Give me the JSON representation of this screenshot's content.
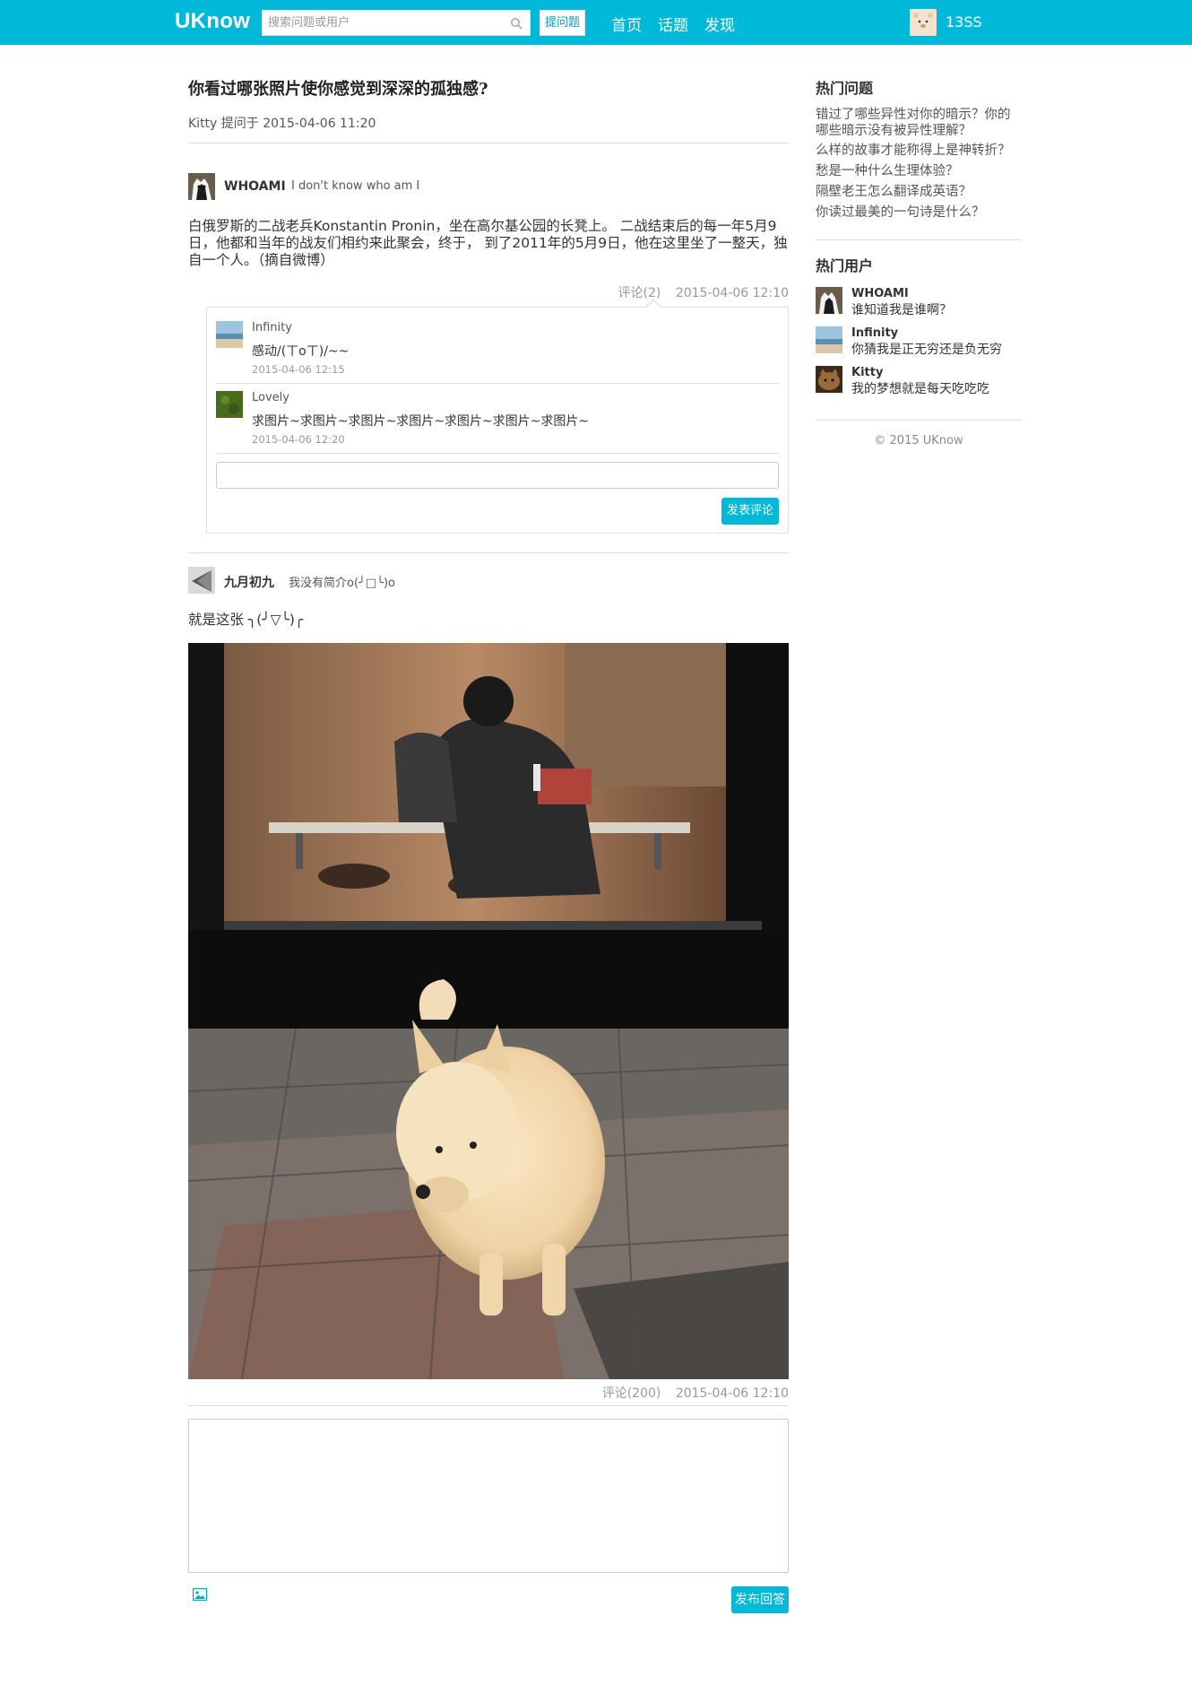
{
  "navbar": {
    "logo": "UKnow",
    "search_placeholder": "搜索问题或用户",
    "ask_button": "提问题",
    "links": [
      "首页",
      "话题",
      "发现"
    ],
    "user_name": "13SS",
    "accent_color": "#00b8d8"
  },
  "question": {
    "title": "你看过哪张照片使你感觉到深深的孤独感?",
    "meta": "Kitty 提问于 2015-04-06 11:20"
  },
  "answers": [
    {
      "author": "WHOAMI",
      "bio": "I don't know who am I",
      "body": "白俄罗斯的二战老兵Konstantin Pronin，坐在高尔基公园的长凳上。 二战结束后的每一年5月9日，他都和当年的战友们相约来此聚会，终于， 到了2011年的5月9日，他在这里坐了一整天，独自一个人。（摘自微博）",
      "comments_label": "评论(2)",
      "time": "2015-04-06 12:10",
      "comments": [
        {
          "author": "Infinity",
          "text": "感动/(ㄒoㄒ)/~~",
          "time": "2015-04-06 12:15"
        },
        {
          "author": "Lovely",
          "text": "求图片~求图片~求图片~求图片~求图片~求图片~求图片~",
          "time": "2015-04-06 12:20"
        }
      ],
      "comment_submit": "发表评论"
    },
    {
      "author": "九月初九",
      "bio": "我没有简介o(╯□╰)o",
      "body": "就是这张 ╮(╯▽╰)╭",
      "comments_label": "评论(200)",
      "time": "2015-04-06 12:10",
      "image": "photo of a white dog outside a window, a person sitting alone inside"
    }
  ],
  "answer_submit": "发布回答",
  "sidebar": {
    "hot_questions_title": "热门问题",
    "hot_questions": [
      "错过了哪些异性对你的暗示？你的哪些暗示没有被异性理解？",
      "么样的故事才能称得上是神转折？",
      "愁是一种什么生理体验？",
      "隔壁老王怎么翻译成英语？",
      "你读过最美的一句诗是什么？"
    ],
    "hot_users_title": "热门用户",
    "hot_users": [
      {
        "name": "WHOAMI",
        "bio": "谁知道我是谁啊？"
      },
      {
        "name": "Infinity",
        "bio": "你猜我是正无穷还是负无穷"
      },
      {
        "name": "Kitty",
        "bio": "我的梦想就是每天吃吃吃"
      }
    ],
    "copyright": "© 2015 UKnow"
  }
}
